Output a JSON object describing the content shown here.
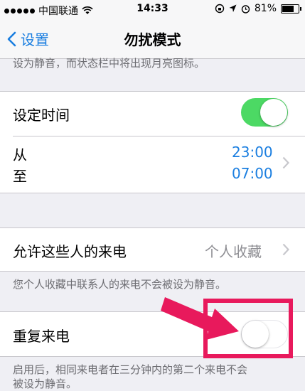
{
  "status_bar": {
    "carrier": "中国联通",
    "time": "14:33",
    "battery": "81%",
    "battery_level": 0.81
  },
  "nav": {
    "back_label": "设置",
    "title": "勿扰模式"
  },
  "top_caption": "设为静音，而状态栏中将出现月亮图标。",
  "scheduled": {
    "label": "设定时间",
    "enabled": true,
    "from_label": "从",
    "to_label": "至",
    "from_time": "23:00",
    "to_time": "07:00"
  },
  "allow_calls": {
    "label": "允许这些人的来电",
    "value": "个人收藏",
    "note": "您个人收藏中联系人的来电不会被设为静音。"
  },
  "repeated_calls": {
    "label": "重复来电",
    "enabled": false,
    "note_line1": "启用后，相同来电者在三分钟内的第二个来电不会",
    "note_line2": "被设为静音。"
  },
  "colors": {
    "accent": "#1a7ee0",
    "toggle_on": "#4cd964",
    "highlight": "#e8195c"
  }
}
